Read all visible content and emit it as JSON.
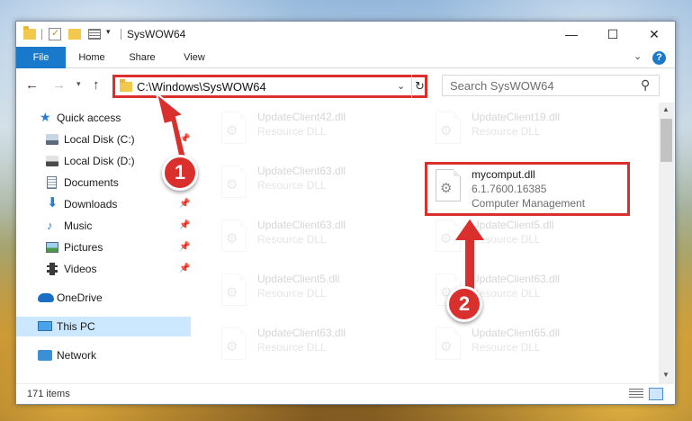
{
  "window": {
    "title": "SysWOW64",
    "min_glyph": "—",
    "max_glyph": "☐",
    "close_glyph": "✕"
  },
  "ribbon": {
    "tabs": [
      {
        "label": "File"
      },
      {
        "label": "Home"
      },
      {
        "label": "Share"
      },
      {
        "label": "View"
      }
    ],
    "help": "?"
  },
  "address": {
    "path": "C:\\Windows\\SysWOW64",
    "search_placeholder": "Search SysWOW64"
  },
  "sidebar": {
    "items": [
      {
        "label": "Quick access",
        "icon": "star-icon"
      },
      {
        "label": "Local Disk (C:)",
        "icon": "disk-icon",
        "pinned": true
      },
      {
        "label": "Local Disk (D:)",
        "icon": "disk-icon"
      },
      {
        "label": "Documents",
        "icon": "documents-icon",
        "pinned": true
      },
      {
        "label": "Downloads",
        "icon": "download-icon",
        "pinned": true
      },
      {
        "label": "Music",
        "icon": "music-icon",
        "pinned": true
      },
      {
        "label": "Pictures",
        "icon": "pictures-icon",
        "pinned": true
      },
      {
        "label": "Videos",
        "icon": "videos-icon",
        "pinned": true
      },
      {
        "label": "OneDrive",
        "icon": "onedrive-icon"
      },
      {
        "label": "This PC",
        "icon": "pc-icon",
        "selected": true
      },
      {
        "label": "Network",
        "icon": "network-icon"
      }
    ]
  },
  "files": {
    "left": [
      {
        "name": "UpdateClient42.dll",
        "type": "Resource DLL"
      },
      {
        "name": "UpdateClient63.dll",
        "type": "Resource DLL"
      },
      {
        "name": "UpdateClient63.dll",
        "type": "Resource DLL"
      },
      {
        "name": "UpdateClient5.dll",
        "type": "Resource DLL"
      },
      {
        "name": "UpdateClient63.dll",
        "type": "Resource DLL"
      }
    ],
    "right": [
      {
        "name": "UpdateClient19.dll",
        "type": "Resource DLL"
      },
      {
        "name": "mycomput.dll",
        "version": "6.1.7600.16385",
        "desc": "Computer Management",
        "highlighted": true
      },
      {
        "name": "UpdateClient5.dll",
        "type": "Resource DLL"
      },
      {
        "name": "UpdateClient63.dll",
        "type": "Resource DLL"
      },
      {
        "name": "UpdateClient65.dll",
        "type": "Resource DLL"
      }
    ]
  },
  "status": {
    "items_count": "171 items"
  },
  "annotations": {
    "badge1": "1",
    "badge2": "2",
    "accent": "#d9302e"
  }
}
